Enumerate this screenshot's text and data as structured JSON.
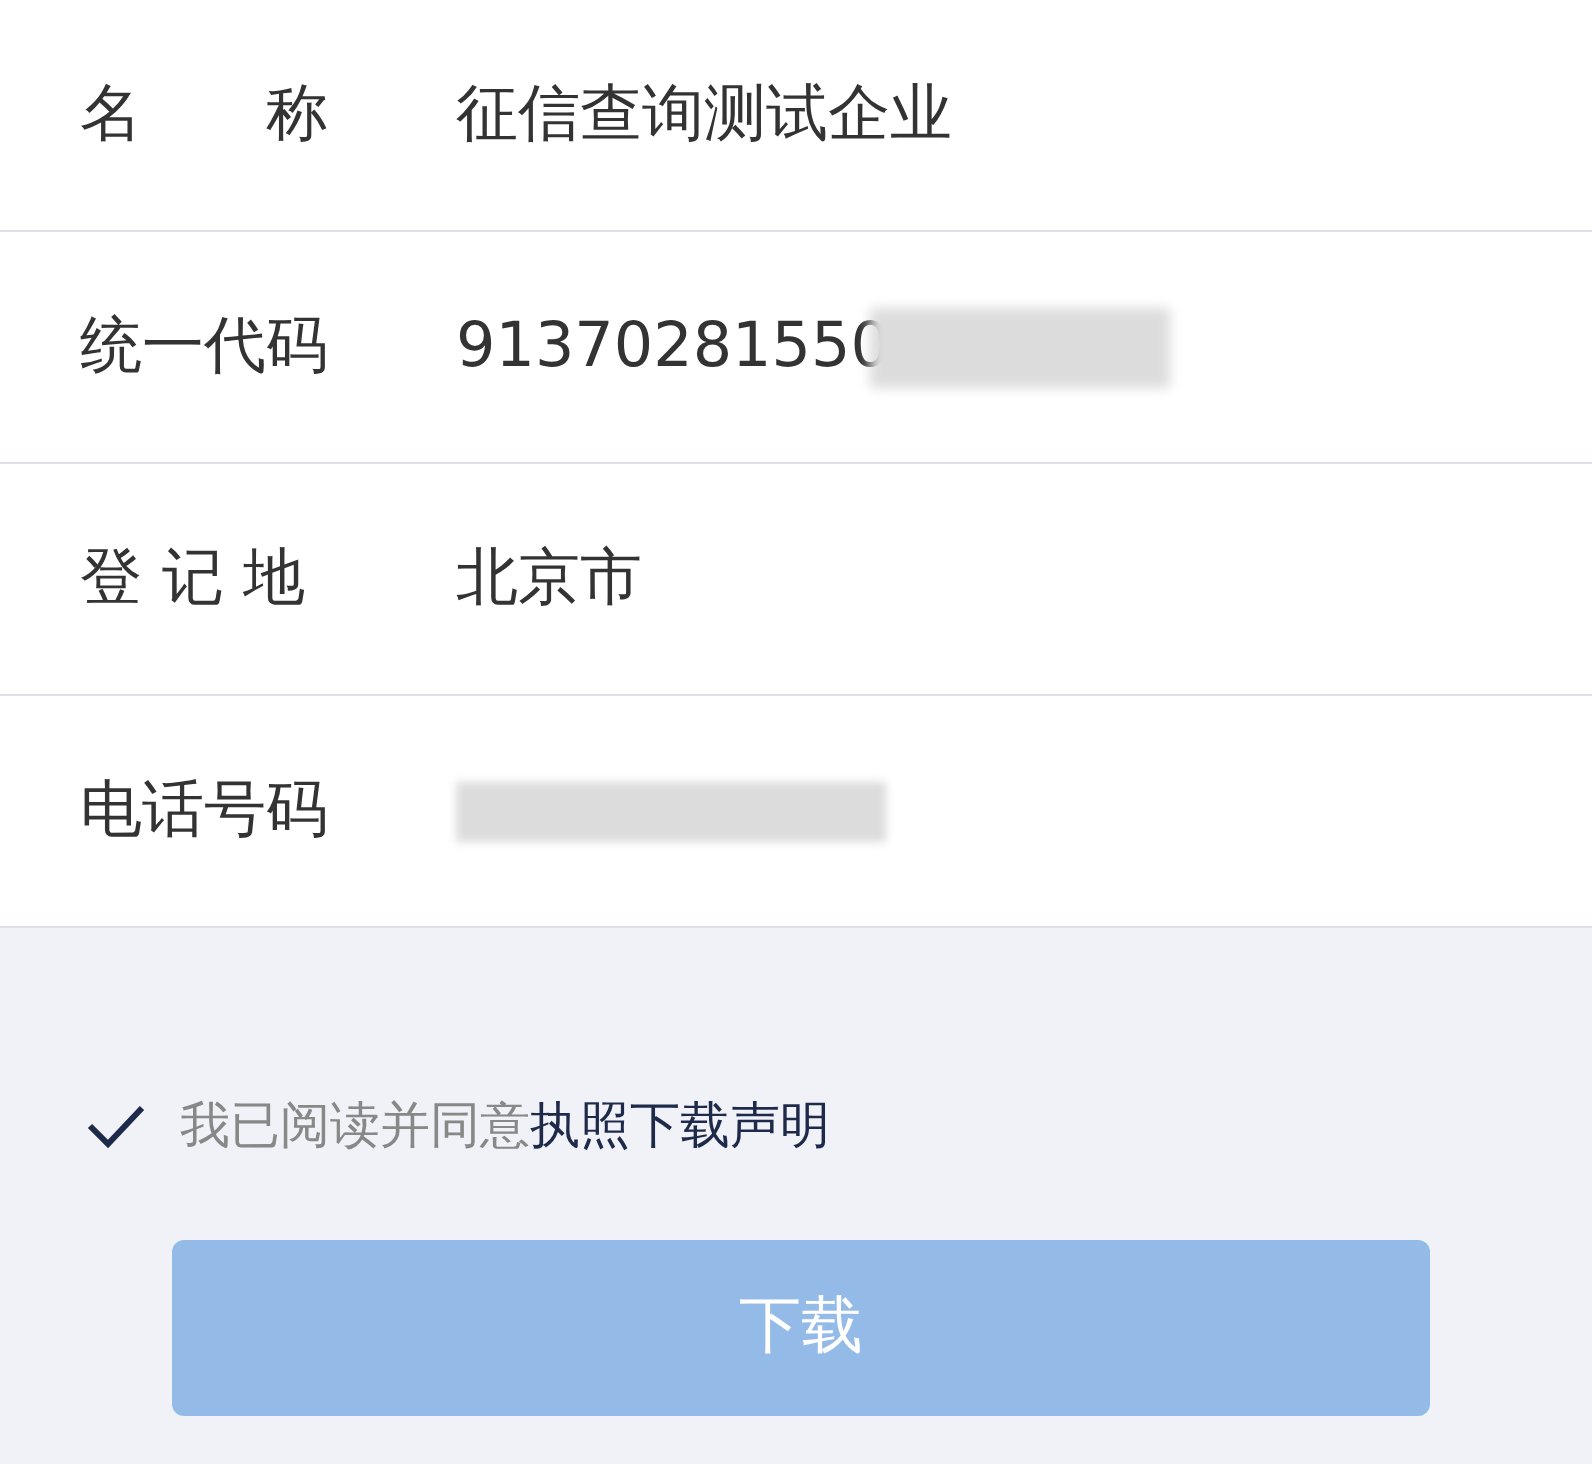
{
  "fields": [
    {
      "label": "名　　称",
      "value": "征信查询测试企业",
      "redacted": false
    },
    {
      "label": "统一代码",
      "value": "91370281550",
      "redacted": true
    },
    {
      "label": "登 记 地",
      "value": "北京市",
      "redacted": false
    },
    {
      "label": "电话号码",
      "redacted": true
    }
  ],
  "agreement": {
    "checked": true,
    "text": "我已阅读并同意",
    "link": "执照下载声明"
  },
  "button": {
    "label": "下载",
    "disabled": true
  }
}
